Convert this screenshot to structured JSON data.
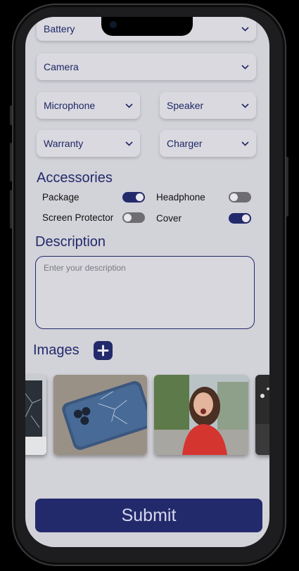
{
  "dropdowns": {
    "battery": "Battery",
    "camera": "Camera",
    "microphone": "Microphone",
    "speaker": "Speaker",
    "warranty": "Warranty",
    "charger": "Charger"
  },
  "accessories": {
    "title": "Accessories",
    "items": [
      {
        "label": "Package",
        "on": true
      },
      {
        "label": "Headphone",
        "on": false
      },
      {
        "label": "Screen Protector",
        "on": false
      },
      {
        "label": "Cover",
        "on": true
      }
    ]
  },
  "description": {
    "title": "Description",
    "placeholder": "Enter your description"
  },
  "images": {
    "title": "Images"
  },
  "submit_label": "Submit",
  "colors": {
    "accent": "#232a6b",
    "screen_bg": "#d2d2d9"
  }
}
